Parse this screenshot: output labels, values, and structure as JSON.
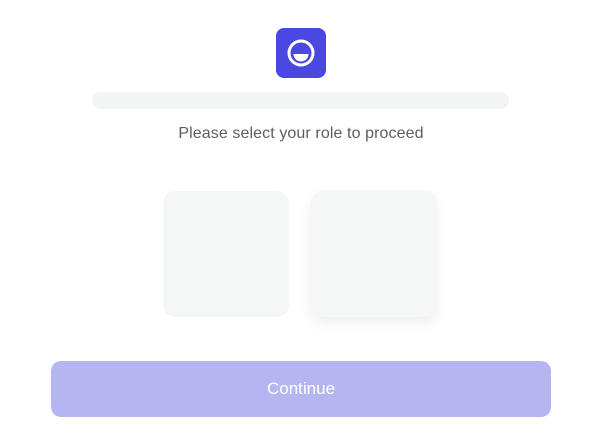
{
  "header": {
    "logo_icon": "smile-circle-icon",
    "brand_color": "#4a48e0"
  },
  "main": {
    "prompt": "Please select your role to proceed",
    "role_cards": [
      {
        "icon": "",
        "label": ""
      },
      {
        "icon": "",
        "label": ""
      }
    ]
  },
  "footer": {
    "continue_label": "Continue",
    "continue_color": "#b5b6f1"
  }
}
